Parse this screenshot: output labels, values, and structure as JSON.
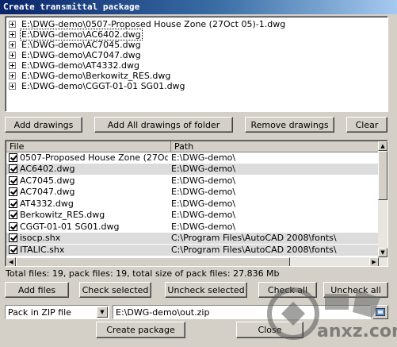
{
  "window": {
    "title": "Create transmittal package"
  },
  "tree": {
    "items": [
      {
        "label": "E:\\DWG-demo\\0507-Proposed House Zone (27Oct 05)-1.dwg",
        "selected": false
      },
      {
        "label": "E:\\DWG-demo\\AC6402.dwg",
        "selected": true
      },
      {
        "label": "E:\\DWG-demo\\AC7045.dwg",
        "selected": false
      },
      {
        "label": "E:\\DWG-demo\\AC7047.dwg",
        "selected": false
      },
      {
        "label": "E:\\DWG-demo\\AT4332.dwg",
        "selected": false
      },
      {
        "label": "E:\\DWG-demo\\Berkowitz_RES.dwg",
        "selected": false
      },
      {
        "label": "E:\\DWG-demo\\CGGT-01-01 SG01.dwg",
        "selected": false
      }
    ]
  },
  "buttons_top": {
    "add_drawings": "Add drawings",
    "add_all": "Add All drawings of folder",
    "remove": "Remove drawings",
    "clear": "Clear"
  },
  "list": {
    "columns": [
      "File",
      "Path"
    ],
    "rows": [
      {
        "file": "0507-Proposed House Zone (27Oct 05...",
        "path": "E:\\DWG-demo\\",
        "checked": true,
        "shaded": false
      },
      {
        "file": "AC6402.dwg",
        "path": "E:\\DWG-demo\\",
        "checked": true,
        "shaded": true
      },
      {
        "file": "AC7045.dwg",
        "path": "E:\\DWG-demo\\",
        "checked": true,
        "shaded": false
      },
      {
        "file": "AC7047.dwg",
        "path": "E:\\DWG-demo\\",
        "checked": true,
        "shaded": false
      },
      {
        "file": "AT4332.dwg",
        "path": "E:\\DWG-demo\\",
        "checked": true,
        "shaded": false
      },
      {
        "file": "Berkowitz_RES.dwg",
        "path": "E:\\DWG-demo\\",
        "checked": true,
        "shaded": false
      },
      {
        "file": "CGGT-01-01 SG01.dwg",
        "path": "E:\\DWG-demo\\",
        "checked": true,
        "shaded": false
      },
      {
        "file": "isocp.shx",
        "path": "C:\\Program Files\\AutoCAD 2008\\fonts\\",
        "checked": true,
        "shaded": true
      },
      {
        "file": "ITALIC.shx",
        "path": "C:\\Program Files\\AutoCAD 2008\\fonts\\",
        "checked": true,
        "shaded": true
      }
    ]
  },
  "status": {
    "text": "Total files: 19, pack files: 19, total size of pack files: 27.836 Mb"
  },
  "buttons_mid": {
    "add_files": "Add files",
    "check_selected": "Check selected",
    "uncheck_selected": "Uncheck selected",
    "check_all": "Check all",
    "uncheck_all": "Uncheck all"
  },
  "pack": {
    "mode": "Pack in ZIP file",
    "output_path": "E:\\DWG-demo\\out.zip"
  },
  "buttons_bottom": {
    "create": "Create package",
    "close": "Close"
  },
  "watermark": {
    "text": "anxz.com"
  }
}
